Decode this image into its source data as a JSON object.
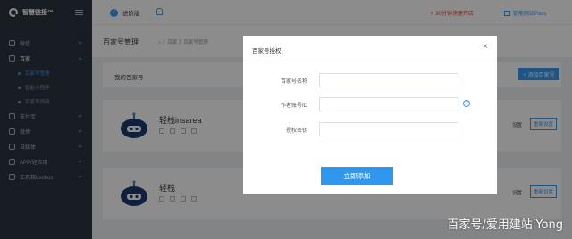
{
  "sidebar": {
    "logo_text": "智慧链接™",
    "items": [
      {
        "label": "微信",
        "icon": "wechat-icon",
        "state": "collapsed"
      },
      {
        "label": "百家",
        "icon": "baijia-icon",
        "state": "open"
      },
      {
        "label": "支付宝",
        "icon": "alipay-icon",
        "state": "collapsed"
      },
      {
        "label": "微博",
        "icon": "weibo-icon",
        "state": "collapsed"
      },
      {
        "label": "自媒体",
        "icon": "media-icon",
        "state": "collapsed"
      },
      {
        "label": "APP/轻应用",
        "icon": "app-icon",
        "state": "collapsed"
      },
      {
        "label": "工具箱toolbox",
        "icon": "toolbox-icon",
        "state": "collapsed"
      }
    ],
    "subitems": [
      {
        "label": "百家号管理",
        "active": true
      },
      {
        "label": "智能小程序",
        "active": false
      },
      {
        "label": "百家号视频",
        "active": false
      }
    ]
  },
  "topbar": {
    "version_label": "进阶版",
    "promo_text": "30分钟快速开店",
    "site_link": "智能网站Pass"
  },
  "page": {
    "title": "百家号管理",
    "breadcrumb": "⌂ 》百家 》百家号管理",
    "panel_title": "我的百家号",
    "add_button": "+ 添加百家号"
  },
  "accounts": [
    {
      "name": "轻栈insarea",
      "settings_link": "设置",
      "reset_button": "重新设置"
    },
    {
      "name": "轻栈",
      "settings_link": "设置",
      "reset_button": "重新设置"
    }
  ],
  "modal": {
    "title": "百家号授权",
    "close": "×",
    "fields": [
      {
        "label": "百家号名称",
        "value": "",
        "placeholder": ""
      },
      {
        "label": "作者账号ID",
        "value": "",
        "placeholder": ""
      },
      {
        "label": "授权密钥",
        "value": "",
        "placeholder": ""
      }
    ],
    "help_glyph": "?",
    "submit_button": "立即添加"
  },
  "watermark": "百家号/爱用建站iYong",
  "colors": {
    "accent": "#3a9bf0",
    "sidebar": "#2c3440",
    "promo": "#e9423a"
  }
}
